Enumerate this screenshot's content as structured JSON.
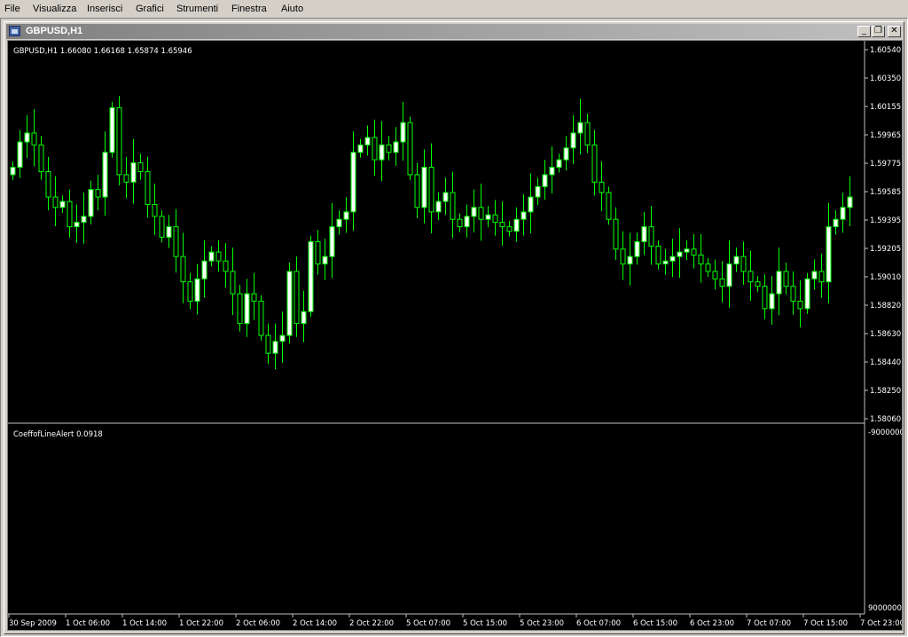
{
  "menu": [
    "File",
    "Visualizza",
    "Inserisci",
    "Grafici",
    "Strumenti",
    "Finestra",
    "Aiuto"
  ],
  "window": {
    "title": "GBPUSD,H1",
    "minimize_glyph": "_",
    "restore_glyph": "❐",
    "close_glyph": "✕"
  },
  "main_panel": {
    "header": "GBPUSD,H1  1.66080 1.66168 1.65874 1.65946"
  },
  "indicator_panel": {
    "header": "CoeffofLineAlert 0.0918",
    "top_label": "-9000000",
    "bottom_label": "9000000"
  },
  "colors": {
    "up_fill": "#ffffff",
    "down_fill": "#000000",
    "wick": "#00ff00",
    "background": "#000000",
    "grid_text": "#ffffff"
  },
  "chart_data": {
    "type": "candlestick",
    "symbol": "GBPUSD",
    "timeframe": "H1",
    "y_ticks": [
      "1.60540",
      "1.60350",
      "1.60155",
      "1.59965",
      "1.59775",
      "1.59585",
      "1.59395",
      "1.59205",
      "1.59010",
      "1.58820",
      "1.58630",
      "1.58440",
      "1.58250",
      "1.58060"
    ],
    "ylim": [
      1.5806,
      1.6054
    ],
    "x_ticks": [
      "30 Sep 2009",
      "1 Oct 06:00",
      "1 Oct 14:00",
      "1 Oct 22:00",
      "2 Oct 06:00",
      "2 Oct 14:00",
      "2 Oct 22:00",
      "5 Oct 07:00",
      "5 Oct 15:00",
      "5 Oct 23:00",
      "6 Oct 07:00",
      "6 Oct 15:00",
      "6 Oct 23:00",
      "7 Oct 07:00",
      "7 Oct 15:00",
      "7 Oct 23:00"
    ],
    "closes": [
      1.5975,
      1.5992,
      1.5998,
      1.599,
      1.5972,
      1.5955,
      1.5948,
      1.5952,
      1.5935,
      1.5938,
      1.5942,
      1.596,
      1.5955,
      1.5985,
      1.6015,
      1.597,
      1.5965,
      1.5978,
      1.5972,
      1.595,
      1.5942,
      1.5928,
      1.5935,
      1.5915,
      1.5898,
      1.5885,
      1.59,
      1.5912,
      1.5918,
      1.5912,
      1.5905,
      1.589,
      1.587,
      1.589,
      1.5885,
      1.5862,
      1.585,
      1.5858,
      1.5862,
      1.5905,
      1.587,
      1.5878,
      1.5925,
      1.591,
      1.5915,
      1.5935,
      1.594,
      1.5945,
      1.5985,
      1.599,
      1.5995,
      1.598,
      1.599,
      1.5985,
      1.5992,
      1.6005,
      1.597,
      1.5948,
      1.5975,
      1.5945,
      1.5952,
      1.5958,
      1.594,
      1.5935,
      1.5942,
      1.5948,
      1.594,
      1.5943,
      1.5938,
      1.5935,
      1.5932,
      1.594,
      1.5945,
      1.5955,
      1.5962,
      1.597,
      1.5975,
      1.598,
      1.5988,
      1.5998,
      1.6005,
      1.599,
      1.5965,
      1.5958,
      1.594,
      1.592,
      1.591,
      1.5915,
      1.5925,
      1.5935,
      1.5922,
      1.591,
      1.5912,
      1.5915,
      1.5918,
      1.592,
      1.5916,
      1.591,
      1.5905,
      1.59,
      1.5895,
      1.591,
      1.5915,
      1.5905,
      1.5898,
      1.5895,
      1.588,
      1.589,
      1.5905,
      1.5895,
      1.5885,
      1.588,
      1.59,
      1.5905,
      1.5898,
      1.5935,
      1.594,
      1.5948,
      1.5955
    ]
  }
}
